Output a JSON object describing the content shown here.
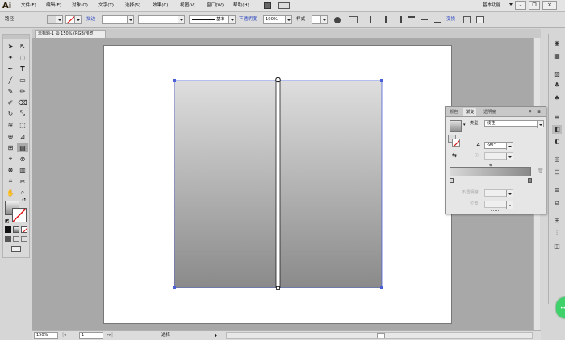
{
  "app": {
    "logo": "Ai",
    "workspace": "基本功能"
  },
  "menu": [
    "文件(F)",
    "编辑(E)",
    "对象(O)",
    "文字(T)",
    "选择(S)",
    "效果(C)",
    "视图(V)",
    "窗口(W)",
    "帮助(H)"
  ],
  "control_bar": {
    "selection_label": "路径",
    "stroke_label": "描边",
    "stroke_value": "",
    "brush_label": "基本",
    "opacity_label": "不透明度",
    "opacity_value": "100%",
    "style_label": "样式",
    "transform_label": "变换"
  },
  "document_tab": {
    "title": "未标题-1 @ 150% (RGB/预览)"
  },
  "status_bar": {
    "zoom": "150%",
    "artboard": "1",
    "tool_info": "选择"
  },
  "gradient_panel": {
    "tabs": [
      "颜色",
      "渐变",
      "透明度"
    ],
    "type_label": "类型",
    "type_value": "线性",
    "angle_value": "-90°",
    "aspect_label": "",
    "opacity_label": "不透明度",
    "location_label": "位置",
    "stop_left_color": "#d8d8d8",
    "stop_right_color": "#888888"
  },
  "artwork": {
    "gradient_top": "#dddddd",
    "gradient_bottom": "#8a8a8a",
    "selection_color": "#4a5fd8"
  },
  "icons": {
    "tools": [
      "selection-icon",
      "direct-selection-icon",
      "magic-wand-icon",
      "lasso-icon",
      "pen-icon",
      "type-icon",
      "line-icon",
      "rectangle-icon",
      "paintbrush-icon",
      "pencil-icon",
      "blob-brush-icon",
      "eraser-icon",
      "rotate-icon",
      "scale-icon",
      "warp-icon",
      "free-transform-icon",
      "shape-builder-icon",
      "perspective-icon",
      "mesh-icon",
      "gradient-icon",
      "eyedropper-icon",
      "blend-icon",
      "symbol-sprayer-icon",
      "column-graph-icon",
      "artboard-icon",
      "slice-icon",
      "hand-icon",
      "zoom-icon"
    ]
  }
}
